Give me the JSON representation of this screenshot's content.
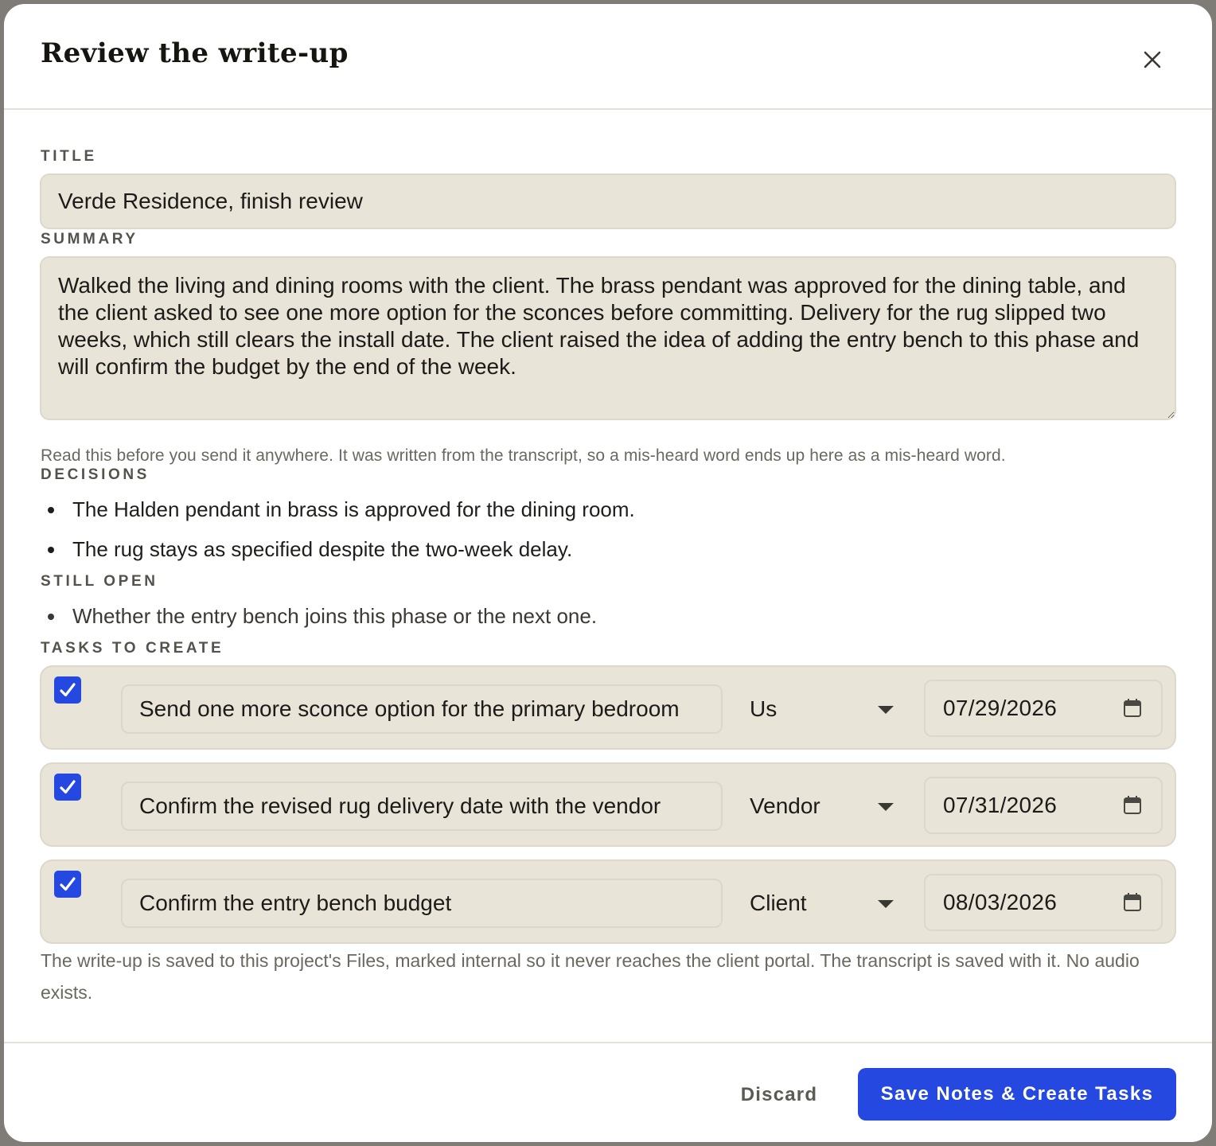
{
  "modal": {
    "title": "Review the write-up",
    "close_icon": "close-icon"
  },
  "title_field": {
    "label": "TITLE",
    "value": "Verde Residence, finish review"
  },
  "summary_field": {
    "label": "SUMMARY",
    "value": "Walked the living and dining rooms with the client. The brass pendant was approved for the dining table, and the client asked to see one more option for the sconces before committing. Delivery for the rug slipped two weeks, which still clears the install date. The client raised the idea of adding the entry bench to this phase and will confirm the budget by the end of the week.",
    "hint": "Read this before you send it anywhere. It was written from the transcript, so a mis-heard word ends up here as a mis-heard word."
  },
  "decisions": {
    "label": "DECISIONS",
    "items": [
      "The Halden pendant in brass is approved for the dining room.",
      "The rug stays as specified despite the two-week delay."
    ]
  },
  "still_open": {
    "label": "STILL OPEN",
    "items": [
      "Whether the entry bench joins this phase or the next one."
    ]
  },
  "tasks": {
    "label": "TASKS TO CREATE",
    "items": [
      {
        "checked": true,
        "name": "Send one more sconce option for the primary bedroom",
        "owner": "Us",
        "due": "07/29/2026"
      },
      {
        "checked": true,
        "name": "Confirm the revised rug delivery date with the vendor",
        "owner": "Vendor",
        "due": "07/31/2026"
      },
      {
        "checked": true,
        "name": "Confirm the entry bench budget",
        "owner": "Client",
        "due": "08/03/2026"
      }
    ]
  },
  "footer_note": "The write-up is saved to this project's Files, marked internal so it never reaches the client portal. The transcript is saved with it. No audio exists.",
  "actions": {
    "discard_label": "Discard",
    "save_label": "Save Notes & Create Tasks"
  },
  "colors": {
    "accent": "#2548e0",
    "field_bg": "#e8e4d7"
  }
}
